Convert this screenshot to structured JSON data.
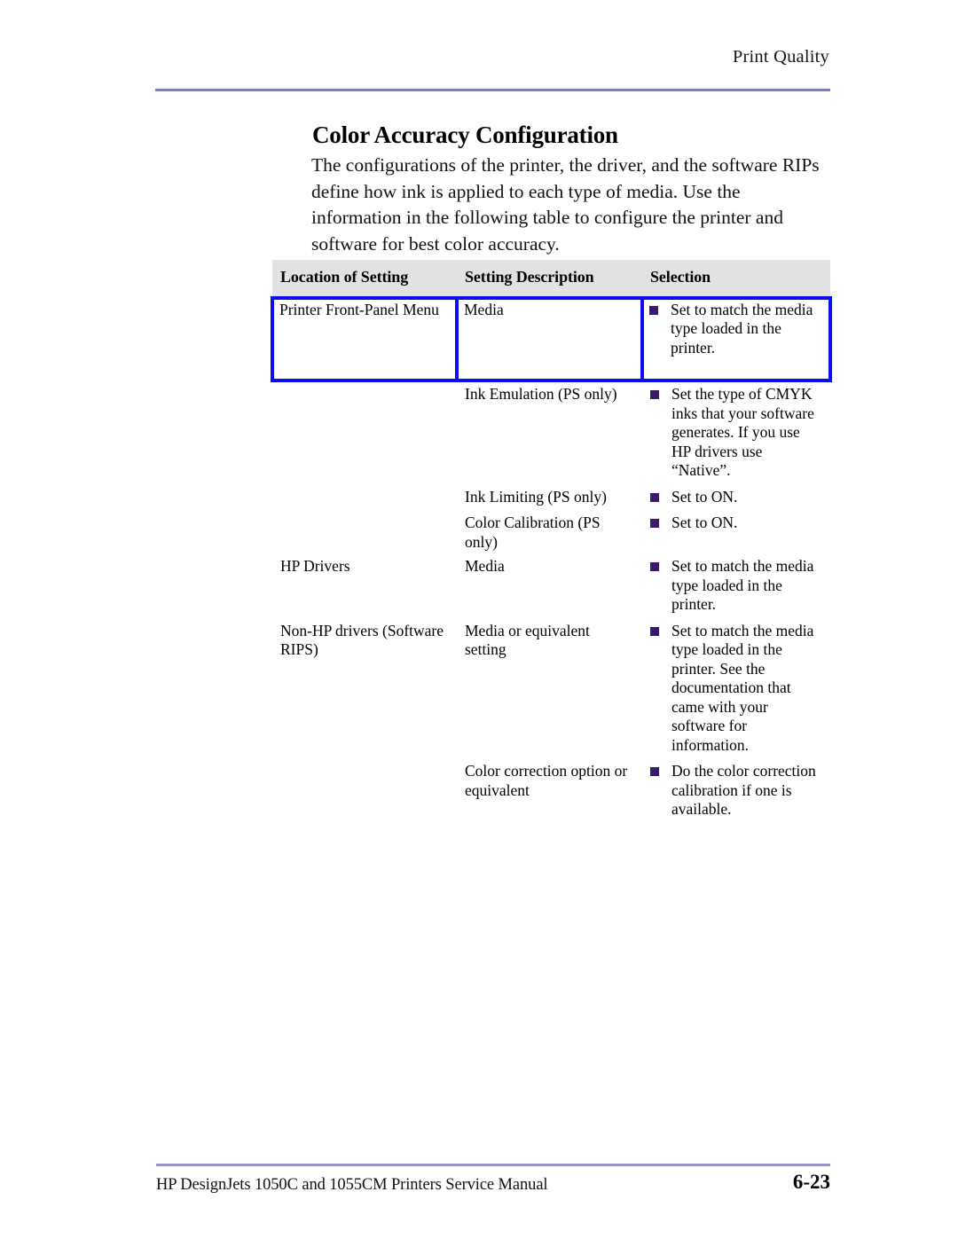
{
  "page": {
    "running_head": "Print Quality",
    "heading": "Color Accuracy Configuration",
    "intro": "The configurations of the printer, the driver, and the software RIPs define how ink is applied to each type of media. Use the information in the following table to configure the printer and software for best color accuracy.",
    "accent_rule_color": "#7f7fbe",
    "footer_rule_color": "#9c93c6",
    "selection_highlight_color": "#0c0cf5",
    "bullet_color": "#3a186c",
    "header_row_background": "#e2e2e2"
  },
  "table": {
    "columns": [
      "Location of Setting",
      "Setting Description",
      "Selection"
    ],
    "rows": [
      {
        "location": "Printer Front-Panel Menu",
        "description": "Media",
        "selection": [
          "Set to match the media type loaded in the printer."
        ],
        "highlighted": true
      },
      {
        "location": "",
        "description": "Ink Emulation (PS only)",
        "selection": [
          "Set the type of CMYK inks that your software generates. If you use HP drivers use “Native”."
        ],
        "highlighted": false
      },
      {
        "location": "",
        "description": "Ink Limiting (PS only)",
        "selection": [
          "Set to ON."
        ],
        "highlighted": false
      },
      {
        "location": "",
        "description": "Color Calibration (PS only)",
        "selection": [
          "Set to ON."
        ],
        "highlighted": false
      },
      {
        "location": "HP Drivers",
        "description": "Media",
        "selection": [
          "Set to match the media type loaded in the printer."
        ],
        "highlighted": false
      },
      {
        "location": "Non-HP drivers (Software RIPS)",
        "description": "Media or equivalent setting",
        "selection": [
          "Set to match the media type loaded in the printer. See the documentation that came with your software for information."
        ],
        "highlighted": false
      },
      {
        "location": "",
        "description": "Color correction option or equivalent",
        "selection": [
          "Do the color correction calibration if one is available."
        ],
        "highlighted": false
      }
    ]
  },
  "footer": {
    "manual_title": "HP DesignJets 1050C and 1055CM Printers Service Manual",
    "page_number": "6-23"
  }
}
